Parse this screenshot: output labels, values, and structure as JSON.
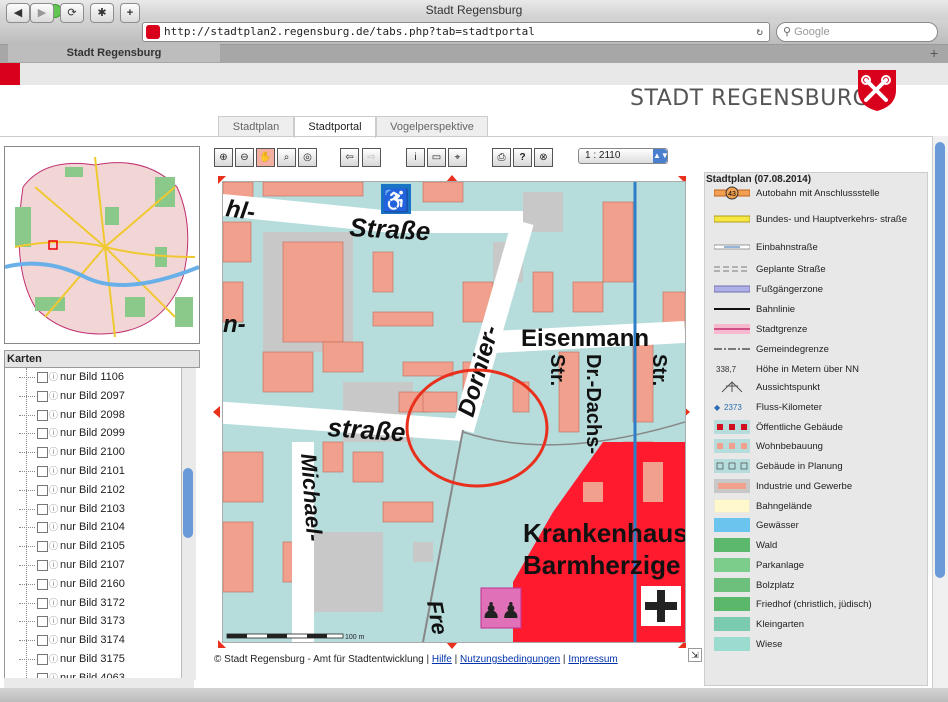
{
  "window": {
    "title": "Stadt Regensburg"
  },
  "browser": {
    "url": "http://stadtplan2.regensburg.de/tabs.php?tab=stadtportal",
    "search_placeholder": "Google",
    "tab_label": "Stadt Regensburg",
    "reload_glyph": "↻"
  },
  "header": {
    "site_title": "STADT REGENSBURG"
  },
  "page_tabs": [
    {
      "label": "Stadtplan",
      "active": false
    },
    {
      "label": "Stadtportal",
      "active": true
    },
    {
      "label": "Vogelperspektive",
      "active": false
    }
  ],
  "karten": {
    "title": "Karten",
    "items": [
      "nur Bild 1106",
      "nur Bild 2097",
      "nur Bild 2098",
      "nur Bild 2099",
      "nur Bild 2100",
      "nur Bild 2101",
      "nur Bild 2102",
      "nur Bild 2103",
      "nur Bild 2104",
      "nur Bild 2105",
      "nur Bild 2107",
      "nur Bild 2160",
      "nur Bild 3172",
      "nur Bild 3173",
      "nur Bild 3174",
      "nur Bild 3175",
      "nur Bild 4063"
    ]
  },
  "map_tools": {
    "zoom_in": "zoom-in-icon",
    "zoom_out": "zoom-out-icon",
    "pan": "hand-icon",
    "zoom_box": "zoom-box-icon",
    "zoom_full": "zoom-full-icon",
    "back": "back-arrow-icon",
    "forward": "forward-arrow-icon",
    "info": "info-icon",
    "measure": "ruler-icon",
    "locate": "crosshair-icon",
    "print": "print-icon",
    "help": "help-icon",
    "close": "close-icon"
  },
  "scale": {
    "value": "1 : 2110"
  },
  "map": {
    "labels": {
      "strasse1": "Straße",
      "hl": "hl-",
      "n": "n-",
      "strasse2": "straße",
      "dornier": "Dornier-",
      "eisenmann": "Eisenmann",
      "str1": "Str.",
      "dachs": "Dr.-Dachs-",
      "str2": "Str.",
      "michael": "Michael-",
      "fre": "Fre",
      "krankenhaus": "Krankenhaus",
      "barmherzige": "Barmherzige",
      "scalebar": "100 m"
    },
    "colors": {
      "base": "#b6dcdc",
      "building": "#f0a08c",
      "street": "#ffffff",
      "hospital": "#ff1a2e",
      "circle": "#e8301c",
      "river": "#2e7fc8"
    }
  },
  "footer": {
    "copyright": "© Stadt Regensburg - Amt für Stadtentwicklung |",
    "sep": "|",
    "links": [
      "Hilfe",
      "Nutzungsbedingungen",
      "Impressum"
    ]
  },
  "legend": {
    "title": "Stadtplan (07.08.2014)",
    "items": [
      {
        "label": "Autobahn mit Anschlussstelle",
        "sym": "autobahn",
        "badge": "43"
      },
      {
        "label": "Bundes- und Hauptverkehrs- straße",
        "sym": "bundes"
      },
      {
        "label": "Einbahnstraße",
        "sym": "einbahn"
      },
      {
        "label": "Geplante Straße",
        "sym": "geplant"
      },
      {
        "label": "Fußgängerzone",
        "sym": "fuss"
      },
      {
        "label": "Bahnlinie",
        "sym": "bahn"
      },
      {
        "label": "Stadtgrenze",
        "sym": "stadtgrenze"
      },
      {
        "label": "Gemeindegrenze",
        "sym": "gemeinde"
      },
      {
        "label": "Höhe in Metern über NN",
        "sym": "hoehe",
        "value": "338,7"
      },
      {
        "label": "Aussichtspunkt",
        "sym": "aussicht"
      },
      {
        "label": "Fluss-Kilometer",
        "sym": "fluss",
        "value": "2373"
      },
      {
        "label": "Öffentliche Gebäude",
        "sym": "oeff"
      },
      {
        "label": "Wohnbebauung",
        "sym": "wohn"
      },
      {
        "label": "Gebäude in Planung",
        "sym": "planung"
      },
      {
        "label": "Industrie und Gewerbe",
        "sym": "industrie"
      },
      {
        "label": "Bahngelände",
        "sym": "bahngel"
      },
      {
        "label": "Gewässer",
        "sym": "gewaesser"
      },
      {
        "label": "Wald",
        "sym": "wald"
      },
      {
        "label": "Parkanlage",
        "sym": "park"
      },
      {
        "label": "Bolzplatz",
        "sym": "bolz"
      },
      {
        "label": "Friedhof (christlich, jüdisch)",
        "sym": "friedhof"
      },
      {
        "label": "Kleingarten",
        "sym": "klein"
      },
      {
        "label": "Wiese",
        "sym": "wiese"
      }
    ]
  }
}
